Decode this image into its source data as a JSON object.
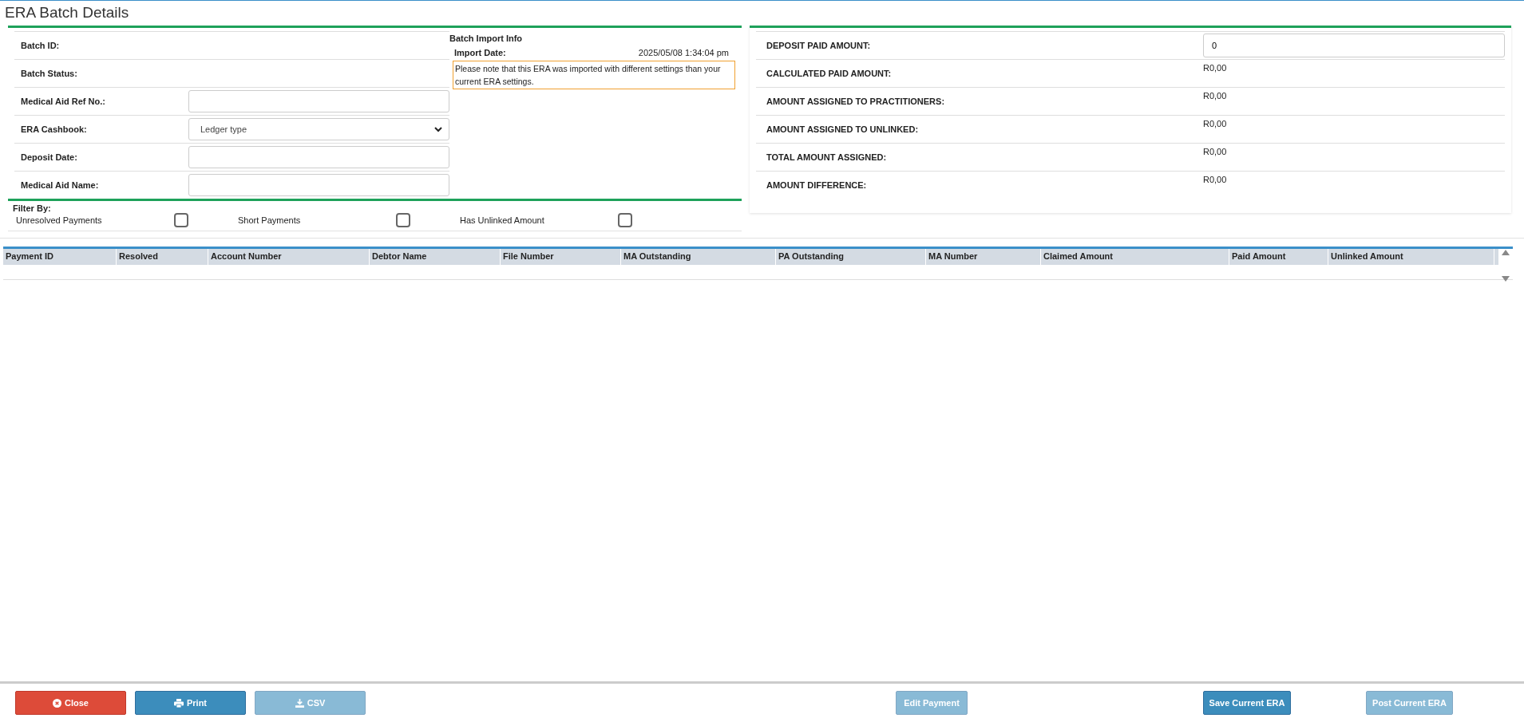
{
  "window": {
    "title": "ERA Batch Details"
  },
  "batch_fields": [
    {
      "kind": "text",
      "label": "Batch ID:"
    },
    {
      "kind": "text",
      "label": "Batch Status:"
    },
    {
      "kind": "input",
      "label": "Medical Aid Ref No.:"
    },
    {
      "kind": "select",
      "label": "ERA Cashbook:",
      "value": "Ledger type"
    },
    {
      "kind": "input",
      "label": "Deposit Date:"
    },
    {
      "kind": "input",
      "label": "Medical Aid Name:"
    }
  ],
  "import_info": {
    "title": "Batch Import Info",
    "date_label": "Import Date:",
    "date_value": "2025/05/08 1:34:04 pm",
    "notice": "Please note that this ERA was imported with different settings than your current ERA settings."
  },
  "filter": {
    "title": "Filter By:",
    "options": [
      {
        "label": "Unresolved Payments",
        "checked": false
      },
      {
        "label": "Short Payments",
        "checked": false
      },
      {
        "label": "Has Unlinked Amount",
        "checked": false
      }
    ]
  },
  "amounts": [
    {
      "kind": "input",
      "label": "DEPOSIT PAID AMOUNT:",
      "value": "0"
    },
    {
      "kind": "text",
      "label": "CALCULATED PAID AMOUNT:",
      "value": "R0,00"
    },
    {
      "kind": "text",
      "label": "AMOUNT ASSIGNED TO PRACTITIONERS:",
      "value": "R0,00"
    },
    {
      "kind": "text",
      "label": "AMOUNT ASSIGNED TO UNLINKED:",
      "value": "R0,00"
    },
    {
      "kind": "text",
      "label": "TOTAL AMOUNT ASSIGNED:",
      "value": "R0,00"
    },
    {
      "kind": "text",
      "label": "AMOUNT DIFFERENCE:",
      "value": "R0,00"
    }
  ],
  "table": {
    "columns": [
      "Payment ID",
      "Resolved",
      "Account Number",
      "Debtor Name",
      "File Number",
      "MA Outstanding",
      "PA Outstanding",
      "MA Number",
      "Claimed Amount",
      "Paid Amount",
      "Unlinked Amount"
    ]
  },
  "buttons": [
    {
      "label": "Close",
      "kind": "danger",
      "disabled": false
    },
    {
      "label": "Print",
      "kind": "primary",
      "disabled": false
    },
    {
      "label": "CSV",
      "kind": "primary",
      "disabled": true
    },
    {
      "label": "Edit Payment",
      "kind": "primary",
      "disabled": true
    },
    {
      "label": "Save Current ERA",
      "kind": "primary",
      "disabled": false
    },
    {
      "label": "Post Current ERA",
      "kind": "primary",
      "disabled": true
    }
  ]
}
